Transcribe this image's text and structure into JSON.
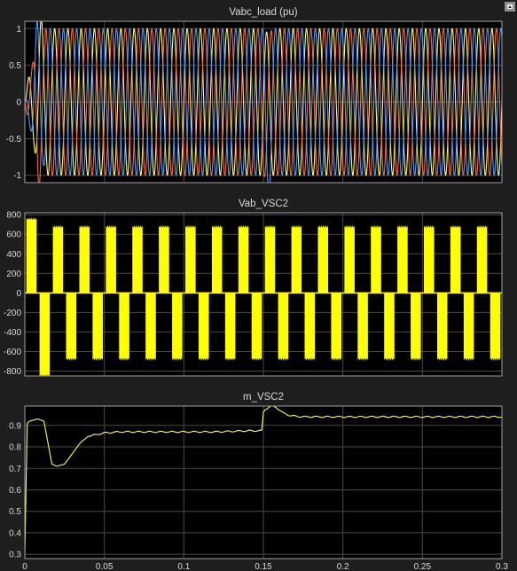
{
  "window": {
    "restore_icon": "restore-layout-icon"
  },
  "colors": {
    "background": "#1e1e1e",
    "axes_bg": "#000000",
    "axes_border": "#a0a0a0",
    "grid": "#4a4a4a",
    "text": "#d8d8d8",
    "phase_a": "#ffff66",
    "phase_b": "#ff6a3c",
    "phase_c": "#4a9cff",
    "vab": "#ffff00",
    "m": "#ffff66"
  },
  "chart_data": [
    {
      "type": "line",
      "title": "Vabc_load (pu)",
      "xlabel": "",
      "ylabel": "",
      "xlim": [
        0,
        0.3
      ],
      "ylim": [
        -1.1,
        1.1
      ],
      "yticks": [
        1,
        0.5,
        0,
        -0.5,
        -1
      ],
      "ytick_labels": [
        "1",
        "0.5",
        "0",
        "-0.5",
        "-1"
      ],
      "xticks": [
        0,
        0.05,
        0.1,
        0.15,
        0.2,
        0.25,
        0.3
      ],
      "grid": true,
      "frequency_hz": 120,
      "amplitude": 1,
      "series": [
        {
          "color": "#ffff66",
          "phase_deg": 0
        },
        {
          "color": "#ff6a3c",
          "phase_deg": -120
        },
        {
          "color": "#4a9cff",
          "phase_deg": 120
        }
      ],
      "startup_transient_end": 0.008,
      "disturbance_time": 0.15
    },
    {
      "type": "line",
      "title": "Vab_VSC2",
      "xlabel": "",
      "ylabel": "",
      "xlim": [
        0,
        0.3
      ],
      "ylim": [
        -850,
        820
      ],
      "yticks": [
        800,
        600,
        400,
        200,
        0,
        -200,
        -400,
        -600,
        -800
      ],
      "ytick_labels": [
        "800",
        "600",
        "400",
        "200",
        "0",
        "-200",
        "-400",
        "-600",
        "-800"
      ],
      "xticks": [
        0,
        0.05,
        0.1,
        0.15,
        0.2,
        0.25,
        0.3
      ],
      "grid": true,
      "frequency_hz": 60,
      "level": 680,
      "startup_peak": 760,
      "startup_trough": -850
    },
    {
      "type": "line",
      "title": "m_VSC2",
      "xlabel": "",
      "ylabel": "",
      "xlim": [
        0,
        0.3
      ],
      "ylim": [
        0.28,
        0.99
      ],
      "yticks": [
        0.9,
        0.8,
        0.7,
        0.6,
        0.5,
        0.4,
        0.3
      ],
      "ytick_labels": [
        "0.9",
        "0.8",
        "0.7",
        "0.6",
        "0.5",
        "0.4",
        "0.3"
      ],
      "xticks": [
        0,
        0.05,
        0.1,
        0.15,
        0.2,
        0.25,
        0.3
      ],
      "xtick_labels": [
        "0",
        "0.05",
        "0.1",
        "0.15",
        "0.2",
        "0.25",
        "0.3"
      ],
      "grid": true,
      "x": [
        0,
        0.0015,
        0.003,
        0.008,
        0.012,
        0.015,
        0.017,
        0.02,
        0.025,
        0.03,
        0.035,
        0.04,
        0.05,
        0.06,
        0.08,
        0.1,
        0.12,
        0.14,
        0.149,
        0.15,
        0.151,
        0.155,
        0.158,
        0.162,
        0.167,
        0.175,
        0.19,
        0.22,
        0.26,
        0.3
      ],
      "y": [
        0.3,
        0.91,
        0.92,
        0.93,
        0.92,
        0.8,
        0.72,
        0.71,
        0.72,
        0.77,
        0.82,
        0.85,
        0.865,
        0.87,
        0.87,
        0.87,
        0.87,
        0.875,
        0.875,
        0.96,
        0.975,
        0.99,
        0.985,
        0.96,
        0.945,
        0.94,
        0.94,
        0.94,
        0.94,
        0.94
      ]
    }
  ]
}
